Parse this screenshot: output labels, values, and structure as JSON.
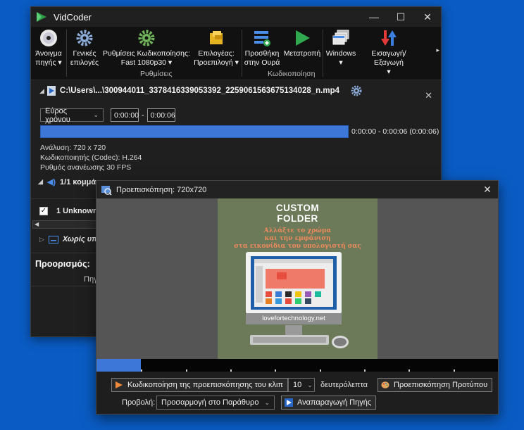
{
  "app": {
    "title": "VidCoder"
  },
  "window_controls": {
    "minimize": "—",
    "maximize": "☐",
    "close": "✕"
  },
  "ribbon": {
    "open_source": "Άνοιγμα πηγής ▾",
    "open_source_l1": "Άνοιγμα",
    "open_source_l2": "πηγής ▾",
    "general_options_l1": "Γενικές",
    "general_options_l2": "επιλογές",
    "encoding_settings_l1": "Ρυθμίσεις Κωδικοποίησης:",
    "encoding_settings_l2": "Fast 1080p30 ▾",
    "picker_l1": "Επιλογέας:",
    "picker_l2": "Προεπιλογή ▾",
    "add_queue_l1": "Προσθήκη",
    "add_queue_l2": "στην Ουρά",
    "convert": "Μετατροπή",
    "windows_l1": "Windows",
    "windows_l2": "▾",
    "import_export_l1": "Εισαγωγή/Εξαγωγή",
    "import_export_l2": "▾",
    "group_settings": "Ρυθμίσεις",
    "group_encoding": "Κωδικοποίηση",
    "more": "▸"
  },
  "source": {
    "path": "C:\\Users\\...\\300944011_3378416339053392_2259061563675134028_n.mp4",
    "close": "✕"
  },
  "range": {
    "type": "Εύρος χρόνου",
    "start": "0:00:00",
    "dash": "-",
    "end": "0:00:06",
    "fill_fraction": 1.0,
    "summary": "0:00:00 - 0:00:06  (0:00:06)"
  },
  "info": {
    "resolution": "Ανάλυση: 720 x 720",
    "codec": "Κωδικοποιητής (Codec): H.264",
    "fps": "Ρυθμός ανανέωσης 30 FPS"
  },
  "audio": {
    "header": "1/1 κομμάτ",
    "arrow": "◢"
  },
  "audio_track": {
    "checked": "✓",
    "label": "1 Unknown"
  },
  "subtitles": {
    "header": "Χωρίς υπ",
    "arrow": "▷"
  },
  "destination": {
    "label": "Προορισμός:",
    "value": "Πηγ"
  },
  "preview": {
    "title": "Προεπισκόπηση: 720x720",
    "close": "✕",
    "thumb": {
      "heading1": "CUSTOM",
      "heading2": "FOLDER",
      "sub1": "Αλλάξτε το χρώμα",
      "sub2": "και την εμφάνιση",
      "sub3": "στα εικονίδια του υπολογιστή σας",
      "site": "lovefortechnology.net"
    },
    "seek_fraction": 0.11,
    "encode_clip_button": "Κωδικοποίηση της προεπισκόπησης του κλιπ",
    "seconds_value": "10",
    "seconds_label": "δευτερόλεπτα",
    "template_preview_button": "Προεπισκόπηση Προτύπου",
    "view_label": "Προβολή:",
    "view_value": "Προσαρμογή στο Παράθυρο",
    "play_source_button": "Αναπαραγωγή Πηγής"
  },
  "colors": {
    "accent_blue": "#3d78d8",
    "desktop": "#0a5cc4",
    "convert_green": "#2fa84f",
    "thumb_bg": "#6d7a5a",
    "thumb_text_orange": "#f08a5d"
  }
}
